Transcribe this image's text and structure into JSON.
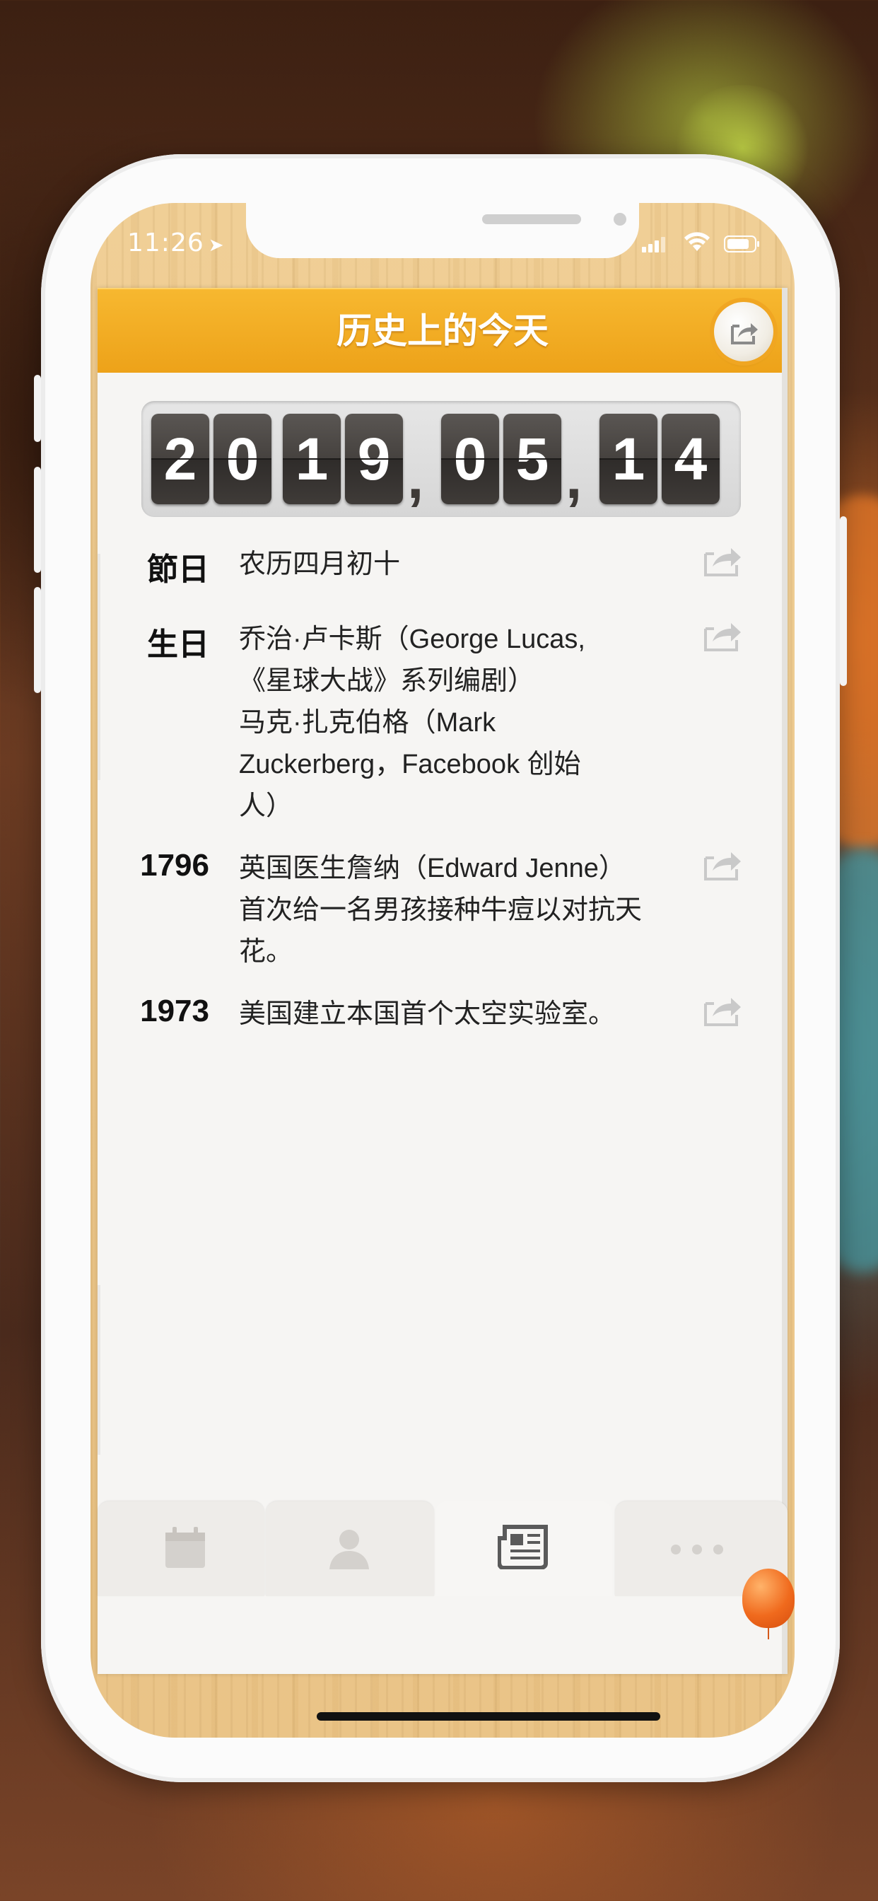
{
  "status_bar": {
    "time": "11:26",
    "location_glyph": "➤"
  },
  "header": {
    "title": "历史上的今天",
    "share_icon": "share-icon"
  },
  "date_display": {
    "year_digits": [
      "2",
      "0",
      "1",
      "9"
    ],
    "month_digits": [
      "0",
      "5"
    ],
    "day_digits": [
      "1",
      "4"
    ],
    "separator": ","
  },
  "events": [
    {
      "label": "節日",
      "lines": [
        "农历四月初十"
      ]
    },
    {
      "label": "生日",
      "lines": [
        "乔治·卢卡斯（George Lucas,",
        "《星球大战》系列编剧）",
        "马克·扎克伯格（Mark",
        "Zuckerberg，Facebook 创始",
        "人）"
      ]
    },
    {
      "label": "1796",
      "lines": [
        "英国医生詹纳（Edward Jenne）",
        "首次给一名男孩接种牛痘以对抗天",
        "花。"
      ]
    },
    {
      "label": "1973",
      "lines": [
        "美国建立本国首个太空实验室。"
      ]
    }
  ],
  "tabbar": {
    "tabs": [
      {
        "icon": "calendar-icon",
        "active": false
      },
      {
        "icon": "person-icon",
        "active": false
      },
      {
        "icon": "newspaper-icon",
        "active": true
      },
      {
        "icon": "more-icon",
        "active": false
      }
    ]
  },
  "colors": {
    "header_orange": "#f0a622",
    "wood": "#eac487",
    "digit_bg": "#3f3b38"
  }
}
